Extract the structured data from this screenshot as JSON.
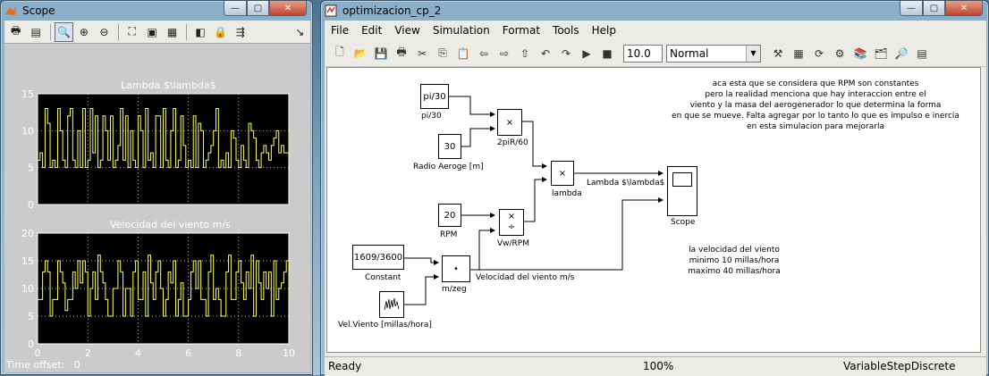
{
  "scope": {
    "title": "Scope",
    "plot1_title": "Lambda $\\lambda$",
    "plot2_title": "Velocidad del viento m/s",
    "plot1_yticks": [
      "15",
      "10",
      "5",
      "0"
    ],
    "plot2_yticks": [
      "20",
      "15",
      "10",
      "5",
      "0"
    ],
    "xticks": [
      "0",
      "2",
      "4",
      "6",
      "8",
      "10"
    ],
    "time_offset_label": "Time offset:",
    "time_offset_value": "0",
    "plot1_series": [
      6,
      7,
      5,
      13,
      11,
      5,
      6,
      5,
      13,
      10,
      6,
      5,
      12,
      13,
      6,
      5,
      10,
      5,
      13,
      5,
      6,
      13,
      7,
      12,
      5,
      6,
      12,
      10,
      6,
      12,
      5,
      6,
      8,
      13,
      6,
      12,
      5,
      10,
      6,
      5,
      12,
      10,
      5,
      13,
      6,
      7,
      5,
      12,
      12,
      5,
      13,
      6,
      5,
      10,
      13,
      5,
      6,
      12,
      8,
      5,
      6,
      5,
      12,
      5,
      11,
      10,
      5,
      6,
      7,
      8,
      10,
      13,
      5,
      6,
      5,
      7,
      5,
      10,
      9,
      6,
      5,
      8,
      6,
      5,
      11,
      10,
      9,
      6,
      5,
      7,
      8,
      7,
      6,
      8,
      9,
      10,
      7,
      8,
      7,
      7,
      10
    ],
    "plot2_series": [
      8,
      8,
      13,
      15,
      13,
      5,
      8,
      8,
      15,
      13,
      11,
      6,
      8,
      8,
      13,
      10,
      15,
      11,
      15,
      13,
      5,
      10,
      13,
      8,
      16,
      13,
      11,
      8,
      5,
      5,
      10,
      10,
      15,
      13,
      5,
      10,
      10,
      5,
      13,
      15,
      8,
      8,
      13,
      5,
      16,
      11,
      8,
      13,
      15,
      10,
      5,
      8,
      13,
      11,
      15,
      5,
      8,
      11,
      5,
      5,
      8,
      13,
      15,
      10,
      15,
      8,
      8,
      5,
      13,
      16,
      8,
      10,
      8,
      5,
      5,
      13,
      16,
      8,
      8,
      13,
      15,
      11,
      8,
      13,
      10,
      16,
      5,
      15,
      11,
      8,
      13,
      10,
      13,
      5,
      15,
      8,
      10,
      11,
      13,
      15,
      8
    ]
  },
  "sim": {
    "title": "optimizacion_cp_2",
    "menu": [
      "File",
      "Edit",
      "View",
      "Simulation",
      "Format",
      "Tools",
      "Help"
    ],
    "stop_time": "10.0",
    "sim_mode": "Normal",
    "status_ready": "Ready",
    "status_zoom": "100%",
    "status_solver": "VariableStepDiscrete",
    "blocks": {
      "pi30_value": "pi/30",
      "pi30_label": "pi/30",
      "radio_value": "30",
      "radio_label": "Radio Aeroge [m]",
      "mult1_label": "2piR/60",
      "lambda_label": "lambda",
      "rpm_value": "20",
      "rpm_label": "RPM",
      "vwrpm_label": "Vw/RPM",
      "const_value": "1609/3600",
      "const_label": "Constant",
      "mzeg_label": "m/zeg",
      "velviento_label": "Vel.Viento [millas/hora]",
      "scope_label": "Scope",
      "signal_lambda": "Lambda $\\lambda$",
      "signal_vel": "Velocidad del viento m/s"
    },
    "note1": [
      "aca esta que se considera que RPM son constantes",
      "pero la realidad menciona que hay interaccion entre el",
      "viento y la masa del aerogenerador lo que determina la forma",
      "en que se mueve. Falta agregar por lo tanto lo que es impulso e inercia",
      "en esta simulacion para mejorarla"
    ],
    "note2": [
      "la velocidad del viento",
      "minimo 10 millas/hora",
      "maximo 40 millas/hora"
    ]
  }
}
